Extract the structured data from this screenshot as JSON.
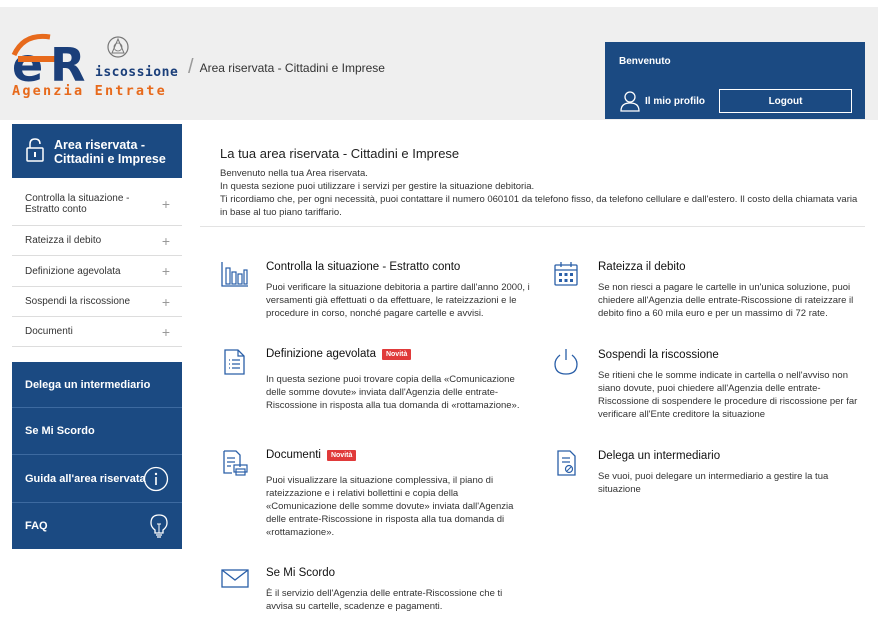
{
  "header": {
    "logo": {
      "letters": "ÆR",
      "riscossione": "iscossione",
      "agenzia": "Agenzia Entrate"
    },
    "breadcrumb": "Area riservata - Cittadini e Imprese",
    "welcome": "Benvenuto",
    "profile_label": "Il mio profilo",
    "logout_label": "Logout"
  },
  "sidebar": {
    "title": "Area riservata - Cittadini e Imprese",
    "items": [
      {
        "label": "Controlla la situazione - Estratto conto"
      },
      {
        "label": "Rateizza il debito"
      },
      {
        "label": "Definizione agevolata"
      },
      {
        "label": "Sospendi la riscossione"
      },
      {
        "label": "Documenti"
      }
    ],
    "links": [
      {
        "label": "Delega un intermediario"
      },
      {
        "label": "Se Mi Scordo"
      },
      {
        "label": "Guida all'area riservata",
        "icon": "info-icon"
      },
      {
        "label": "FAQ",
        "icon": "lightbulb-icon"
      }
    ]
  },
  "main": {
    "title": "La tua area riservata - Cittadini e Imprese",
    "intro": [
      "Benvenuto nella tua Area riservata.",
      "In questa sezione puoi utilizzare i servizi per gestire la situazione debitoria.",
      "Ti ricordiamo che, per ogni necessità, puoi contattare il numero 060101 da telefono fisso, da telefono cellulare e dall'estero. Il costo della chiamata varia in base al tuo piano tariffario."
    ],
    "badge": "Novità",
    "cards": [
      {
        "title": "Controlla la situazione - Estratto conto",
        "icon": "bar-chart-icon",
        "text": "Puoi verificare la situazione debitoria a partire dall'anno 2000, i versamenti già effettuati o da effettuare, le rateizzazioni e le procedure in corso, nonché pagare cartelle e avvisi."
      },
      {
        "title": "Rateizza il debito",
        "icon": "calendar-icon",
        "text": "Se non riesci a pagare le cartelle in un'unica soluzione, puoi chiedere all'Agenzia delle entrate-Riscossione di rateizzare il debito fino a 60 mila euro e per un massimo di 72 rate."
      },
      {
        "title": "Definizione agevolata",
        "icon": "document-list-icon",
        "text": "In questa sezione puoi trovare copia della «Comunicazione delle somme dovute» inviata dall'Agenzia delle entrate-Riscossione in risposta alla tua domanda di «rottamazione»."
      },
      {
        "title": "Sospendi la riscossione",
        "icon": "power-icon",
        "text": "Se ritieni che le somme indicate in cartella o nell'avviso non siano dovute, puoi chiedere all'Agenzia delle entrate-Riscossione di sospendere le procedure di riscossione per far verificare all'Ente creditore la situazione"
      },
      {
        "title": "Documenti",
        "icon": "documents-print-icon",
        "text": "Puoi visualizzare la situazione complessiva, il piano di rateizzazione e i relativi bollettini e copia della «Comunicazione delle somme dovute» inviata dall'Agenzia delle entrate-Riscossione in risposta alla tua domanda di «rottamazione»."
      },
      {
        "title": "Delega un intermediario",
        "icon": "delegate-document-icon",
        "text": "Se vuoi, puoi delegare un intermediario a gestire la tua situazione"
      },
      {
        "title": "Se Mi Scordo",
        "icon": "envelope-icon",
        "text": "È il servizio dell'Agenzia delle entrate-Riscossione che ti avvisa su cartelle, scadenze e pagamenti."
      }
    ]
  },
  "colors": {
    "brand_blue": "#1b4a82",
    "brand_orange": "#e76a1c",
    "badge_red": "#e03a3a",
    "icon_blue": "#2a5fa8"
  }
}
